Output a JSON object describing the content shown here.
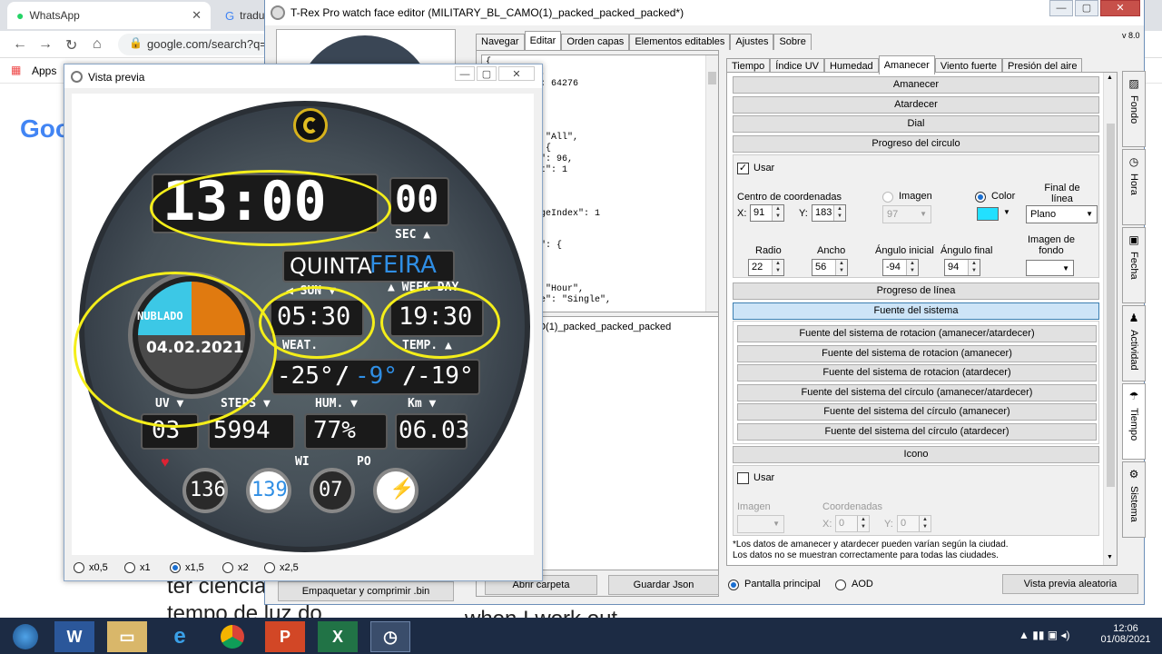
{
  "chrome": {
    "tab1": "WhatsApp",
    "tab2": "tradu",
    "tab_close": "✕",
    "url": "google.com/search?q=",
    "bookmarks_apps": "Apps",
    "google": "Goo",
    "bg_line1": "ter ciencia",
    "bg_line2": "tempo de luz do",
    "bg_line3": "when I work out"
  },
  "editor": {
    "title": "T-Rex Pro watch face editor (MILITARY_BL_CAMO(1)_packed_packed_packed*)",
    "version": "v 8.0",
    "left_tabs": [
      "Navegar",
      "Editar",
      "Orden capas",
      "Elementos editables",
      "Ajustes",
      "Sobre"
    ],
    "right_tabs": [
      "Tiempo",
      "Índice UV",
      "Humedad",
      "Amanecer",
      "Viento fuerte",
      "Presión del aire"
    ],
    "json_lines": [
      "{",
      "        83,",
      "      eId\": 64276",
      "",
      "      \": {",
      "",
      "",
      "      de\": \"All\",",
      "      et\": {",
      "      ndex\": 96,",
      "      Count\": 1",
      "",
      "",
      "",
      "      dImageIndex\": 1",
      "",
      "",
      "      Face\": {",
      "",
      "",
      "",
      "      pe\": \"Hour\",",
      "      gMode\": \"Single\","
    ],
    "tree_lines": [
      "Y_BL_CAMO(1)_packed_packed_packed",
      "",
      "ground",
      "ace",
      "m",
      "enIdle"
    ],
    "sections": {
      "amanecer": "Amanecer",
      "atardecer": "Atardecer",
      "dial": "Dial",
      "progreso_circulo": "Progreso del circulo",
      "progreso_linea": "Progreso de línea",
      "fuente_sistema": "Fuente del sistema",
      "icono": "Icono"
    },
    "circle": {
      "usar": "Usar",
      "centro": "Centro de coordenadas",
      "x_label": "X:",
      "x_val": "91",
      "y_label": "Y:",
      "y_val": "183",
      "imagen": "Imagen",
      "img_val": "97",
      "color": "Color",
      "color_hex": "#22e0ff",
      "final_linea": "Final de línea",
      "final_val": "Plano",
      "radio": "Radio",
      "radio_val": "22",
      "ancho": "Ancho",
      "ancho_val": "56",
      "ang_ini": "Ángulo inicial",
      "ang_ini_val": "-94",
      "ang_fin": "Ángulo final",
      "ang_fin_val": "94",
      "img_fondo": "Imagen de fondo"
    },
    "font_buttons": [
      "Fuente del sistema de rotacion (amanecer/atardecer)",
      "Fuente del sistema de rotacion (amanecer)",
      "Fuente del sistema de rotacion (atardecer)",
      "Fuente del sistema del círculo (amanecer/atardecer)",
      "Fuente del sistema del círculo (amanecer)",
      "Fuente del sistema del círculo (atardecer)"
    ],
    "icono": {
      "usar": "Usar",
      "imagen": "Imagen",
      "coords": "Coordenadas",
      "x": "X:",
      "x_val": "0",
      "y": "Y:",
      "y_val": "0"
    },
    "note1": "*Los datos de amanecer y atardecer pueden varían según la ciudad.",
    "note2": "Los datos no se muestran correctamente para todas las ciudades.",
    "side_tabs": [
      "Fondo",
      "Hora",
      "Fecha",
      "Actividad",
      "Tiempo",
      "Sistema"
    ],
    "bottom": {
      "empaquetar": "Empaquetar y comprimir .bin",
      "abrir": "Abrir carpeta",
      "guardar": "Guardar Json",
      "pantalla": "Pantalla principal",
      "aod": "AOD",
      "aleatoria": "Vista previa aleatoria"
    }
  },
  "preview": {
    "title": "Vista previa",
    "scales": [
      "x0,5",
      "x1",
      "x1,5",
      "x2",
      "x2,5"
    ],
    "selected_scale": "x1,5",
    "watch": {
      "time": "13:00",
      "sec": "00",
      "sec_label": "SEC ▲",
      "day1": "QUINTA",
      "day2": "FEIRA",
      "sun_label": "◀ SUN ▼",
      "week_label": "▲ WEEK DAY",
      "sunrise": "05:30",
      "weat_label": "WEAT.",
      "sunset": "19:30",
      "temp_label": "TEMP. ▲",
      "weather": "NUBLADO",
      "date": "04.02.2021",
      "temp_now": "-25°",
      "temp_slash1": "/",
      "temp_mid": "-9°",
      "temp_slash2": "/",
      "temp_low": "-19°",
      "uv_label": "UV ▼",
      "steps_label": "STEPS ▼",
      "hum_label": "HUM. ▼",
      "km_label": "Km ▼",
      "uv": "03",
      "steps": "5994",
      "hum": "77%",
      "km": "06.03",
      "heart": "136",
      "cal": "139",
      "wi_label": "WI",
      "po_label": "PO",
      "wind": "07"
    }
  },
  "taskbar": {
    "time": "12:06",
    "date": "01/08/2021"
  }
}
